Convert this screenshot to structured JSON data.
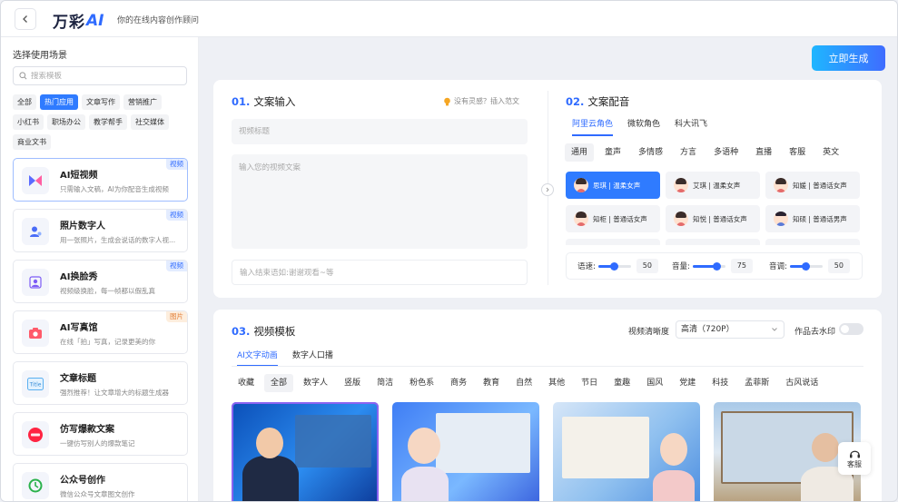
{
  "header": {
    "logo_text": "万彩",
    "logo_ai": "AI",
    "tagline": "你的在线内容创作顾问"
  },
  "sidebar": {
    "title": "选择使用场景",
    "search_placeholder": "搜索模板",
    "tags": [
      "全部",
      "热门应用",
      "文章写作",
      "营销推广",
      "小红书",
      "职场办公",
      "教学帮手",
      "社交媒体",
      "商业文书"
    ],
    "active_tag": "热门应用",
    "cards": [
      {
        "title": "AI短视频",
        "desc": "只需输入文稿，AI为你配音生成视频",
        "badge": "视频",
        "icon": "video-icon"
      },
      {
        "title": "照片数字人",
        "desc": "用一张照片，生成会说话的数字人视...",
        "badge": "视频",
        "icon": "digital-human-icon"
      },
      {
        "title": "AI换脸秀",
        "desc": "视频级换脸，每一帧都以假乱真",
        "badge": "视频",
        "icon": "face-swap-icon"
      },
      {
        "title": "AI写真馆",
        "desc": "在线「拍」写真，记录更美的你",
        "badge": "图片",
        "icon": "camera-icon"
      },
      {
        "title": "文章标题",
        "desc": "强烈推荐！让文章增大的标题生成器",
        "badge": "",
        "icon": "title-icon"
      },
      {
        "title": "仿写爆款文案",
        "desc": "一键仿写别人的爆款笔记",
        "badge": "",
        "icon": "xiaohongshu-icon"
      },
      {
        "title": "公众号创作",
        "desc": "微信公众号文章图文创作",
        "badge": "",
        "icon": "wechat-icon"
      }
    ]
  },
  "actions": {
    "generate_label": "立即生成"
  },
  "copy_input": {
    "num": "01.",
    "title": "文案输入",
    "inspire_label": "没有灵感？插入范文",
    "title_placeholder": "视频标题",
    "body_placeholder": "输入您的视频文案",
    "ending_placeholder": "输入结束语如:谢谢观看~等"
  },
  "voiceover": {
    "num": "02.",
    "title": "文案配音",
    "providers": [
      "阿里云角色",
      "微软角色",
      "科大讯飞"
    ],
    "active_provider": "阿里云角色",
    "categories": [
      "通用",
      "童声",
      "多情感",
      "方言",
      "多语种",
      "直播",
      "客服",
      "英文"
    ],
    "active_category": "通用",
    "voices": [
      {
        "label": "思琪 | 温柔女声",
        "gender": "female"
      },
      {
        "label": "艾琪 | 温柔女声",
        "gender": "female"
      },
      {
        "label": "知媛 | 普通话女声",
        "gender": "female"
      },
      {
        "label": "知柜 | 普通话女声",
        "gender": "female"
      },
      {
        "label": "知悦 | 普通话女声",
        "gender": "female"
      },
      {
        "label": "知硕 | 普通话男声",
        "gender": "male"
      }
    ],
    "active_voice": 0,
    "speed": {
      "label": "语速:",
      "value": "50",
      "level": 0.5
    },
    "volume": {
      "label": "音量:",
      "value": "75",
      "level": 0.75
    },
    "pitch": {
      "label": "音调:",
      "value": "50",
      "level": 0.5
    }
  },
  "templates": {
    "num": "03.",
    "title": "视频模板",
    "resolution_label": "视频清晰度",
    "resolution_value": "高清（720P）",
    "watermark_label": "作品去水印",
    "watermark_on": false,
    "tabs": [
      "AI文字动画",
      "数字人口播"
    ],
    "active_tab": "AI文字动画",
    "categories": [
      "收藏",
      "全部",
      "数字人",
      "竖版",
      "简洁",
      "粉色系",
      "商务",
      "教育",
      "自然",
      "其他",
      "节日",
      "童趣",
      "国风",
      "党建",
      "科技",
      "孟菲斯",
      "古风说话"
    ],
    "active_category": "全部"
  },
  "service": {
    "label": "客服"
  },
  "colors": {
    "accent": "#2f6bff",
    "generate_start": "#1fb6ff",
    "generate_end": "#3f6cff"
  }
}
